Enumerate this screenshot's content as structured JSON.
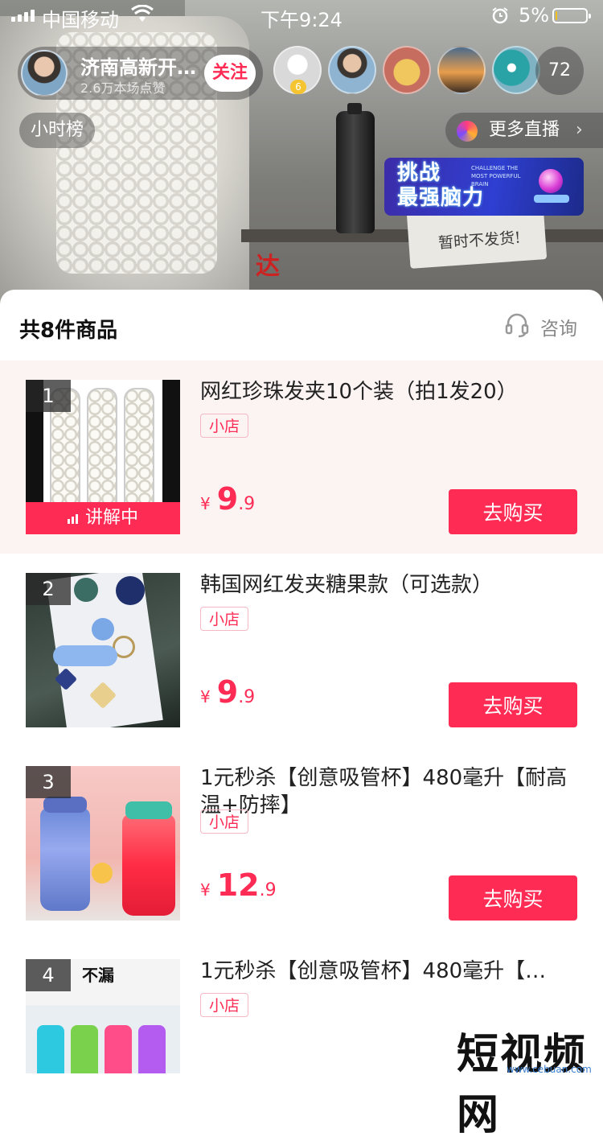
{
  "status_bar": {
    "carrier": "中国移动",
    "time": "下午9:24",
    "battery_percent": "5%",
    "battery_level": 0.05,
    "icons": [
      "signal-icon",
      "wifi-icon",
      "alarm-icon",
      "battery-icon"
    ]
  },
  "live": {
    "host_name": "济南高新开…",
    "host_likes": "2.6万本场点赞",
    "follow_label": "关注",
    "viewer_badge": "6",
    "viewer_count": "72",
    "hour_rank_label": "小时榜",
    "more_live_label": "更多直播",
    "more_live_chevron": "›",
    "banner": {
      "title_line1": "挑战",
      "title_line2": "最强脑力",
      "subtitle": "CHALLENGE THE MOST POWERFUL BRAIN"
    },
    "background_text": {
      "sign": "暂时不发货!",
      "red_char": "达"
    }
  },
  "goods_panel": {
    "title": "共8件商品",
    "consult_label": "咨询",
    "buy_label": "去购买",
    "shop_tag": "小店",
    "explaining_label": "讲解中",
    "items": [
      {
        "rank": "1",
        "title": "网红珍珠发夹10个装（拍1发20）",
        "currency": "¥",
        "price_int": "9",
        "price_dec": ".9"
      },
      {
        "rank": "2",
        "title": "韩国网红发夹糖果款（可选款）",
        "currency": "¥",
        "price_int": "9",
        "price_dec": ".9"
      },
      {
        "rank": "3",
        "title": "1元秒杀【创意吸管杯】480毫升【耐高温+防摔】",
        "currency": "¥",
        "price_int": "12",
        "price_dec": ".9"
      },
      {
        "rank": "4",
        "title": "1元秒杀【创意吸管杯】480毫升【…",
        "thumb_text": "不漏"
      }
    ]
  },
  "watermark": {
    "text": "短视频网",
    "url": "www.cebuan.com"
  },
  "colors": {
    "accent": "#fe2c55",
    "active_row": "#fcf3f3"
  }
}
